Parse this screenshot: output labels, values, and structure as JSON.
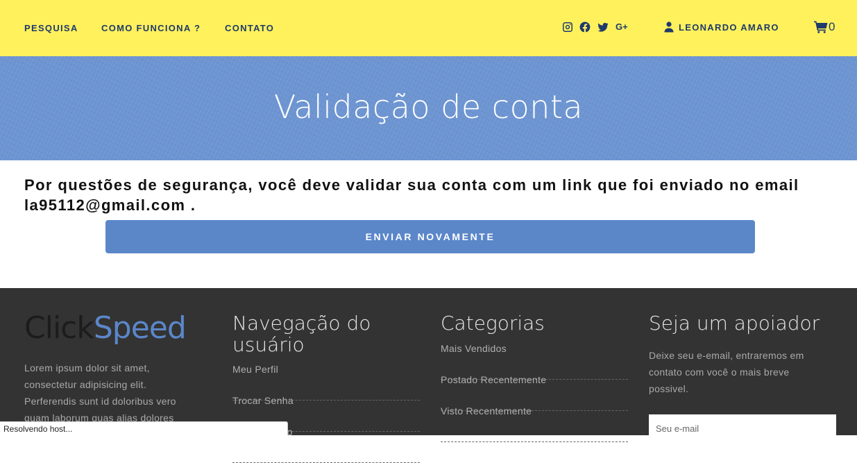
{
  "nav": {
    "items": [
      {
        "label": "PESQUISA"
      },
      {
        "label": "COMO FUNCIONA ?"
      },
      {
        "label": "CONTATO"
      }
    ],
    "social_icons": [
      "instagram-icon",
      "facebook-icon",
      "twitter-icon",
      "google-plus-icon"
    ],
    "gplus_label": "G+",
    "user_name": "LEONARDO AMARO",
    "cart_count": "0"
  },
  "banner": {
    "title": "Validação de conta"
  },
  "main": {
    "message": "Por questões de segurança, você deve validar sua conta com um link que foi enviado no email la95112@gmail.com .",
    "resend_label": "ENVIAR NOVAMENTE"
  },
  "footer": {
    "logo_part1": "Click",
    "logo_part2": "Speed",
    "about_text": "Lorem ipsum dolor sit amet, consectetur adipisicing elit. Perferendis sunt id doloribus vero quam laborum quas alias dolores",
    "nav_title": "Navegação do usuário",
    "nav_links": [
      "Meu Perfil",
      "Trocar Senha",
      "...no"
    ],
    "categories_title": "Categorias",
    "categories": [
      "Mais Vendidos",
      "Postado Recentemente",
      "Visto Recentemente"
    ],
    "support_title": "Seja um apoiador",
    "support_text": "Deixe seu e-email, entraremos em contato com você o mais breve possivel.",
    "email_placeholder": "Seu e-mail"
  },
  "status_bar": "Resolvendo host...",
  "colors": {
    "header_bg": "#fff15c",
    "nav_text": "#1f3a6b",
    "banner_bg": "#6d95d2",
    "accent": "#5b87c9",
    "footer_bg": "#333333"
  }
}
